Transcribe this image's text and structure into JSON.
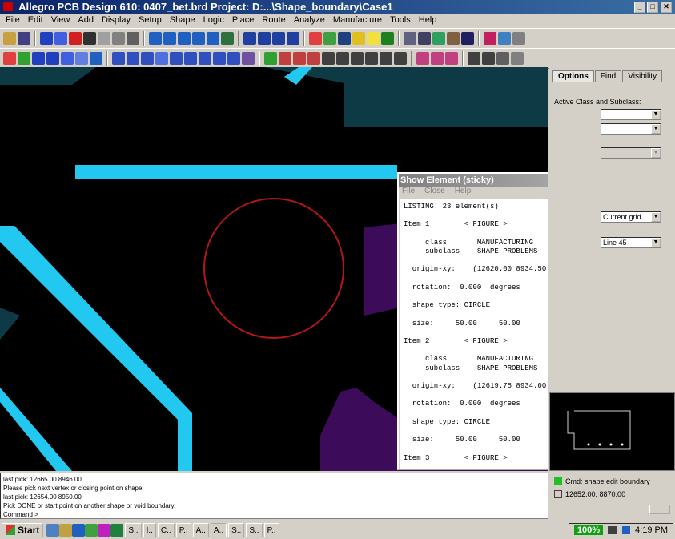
{
  "app": {
    "title": "Allegro PCB Design 610: 0407_bet.brd  Project: D:...\\Shape_boundary\\Case1",
    "window_buttons": [
      "_",
      "□",
      "✕"
    ]
  },
  "menu": [
    "File",
    "Edit",
    "View",
    "Add",
    "Display",
    "Setup",
    "Shape",
    "Logic",
    "Place",
    "Route",
    "Analyze",
    "Manufacture",
    "Tools",
    "Help"
  ],
  "toolbar_icons_row1": [
    "open-icon",
    "save-icon",
    "move-icon",
    "copy-icon",
    "delete-icon",
    "undo-icon",
    "redo-icon",
    "zoom-in-icon",
    "zoom-out-icon",
    "zoom-fit-icon",
    "zoom-prev-icon",
    "zoom-world-icon",
    "add-line-icon",
    "add-rect-icon",
    "add-text-icon",
    "color-icon",
    "layer-icon",
    "grid-icon",
    "display-icon",
    "info-icon"
  ],
  "colors": {
    "canvas_bg": "#000000",
    "cyan_etch": "#22c8f0",
    "dark_teal": "#0e3a46",
    "purple_shape": "#3c0c5a",
    "circle": "#b01818"
  },
  "panel": {
    "tabs": [
      "Options",
      "Find",
      "Visibility"
    ],
    "active_label": "Active Class and Subclass:",
    "combos": [
      "",
      "",
      "",
      "Current grid",
      "Line 45"
    ]
  },
  "show_element": {
    "title": "Show Element (sticky)",
    "menu": [
      "File",
      "Close",
      "Help"
    ],
    "lines": [
      "LISTING: 23 element(s)",
      "",
      "Item 1        < FIGURE >",
      "",
      "     class       MANUFACTURING",
      "     subclass    SHAPE PROBLEMS",
      "",
      "  origin-xy:    (12620.00 8934.50)",
      "",
      "  rotation:  0.000  degrees",
      "",
      "  shape type: CIRCLE",
      "",
      "  size:     50.00     50.00",
      "",
      "Item 2        < FIGURE >",
      "",
      "     class       MANUFACTURING",
      "     subclass    SHAPE PROBLEMS",
      "",
      "  origin-xy:    (12619.75 8934.00)",
      "",
      "  rotation:  0.000  degrees",
      "",
      "  shape type: CIRCLE",
      "",
      "  size:     50.00     50.00",
      "",
      "Item 3        < FIGURE >"
    ]
  },
  "command": {
    "lines": [
      "last pick:  12665.00  8946.00",
      "Please pick next vertex or closing point on shape",
      "last pick:  12654.00  8950.00",
      "Pick DONE or start point on another shape or void boundary.",
      "Command >"
    ]
  },
  "status": {
    "mode": "Cmd:  shape edit boundary",
    "coords": "12652.00, 8870.00"
  },
  "taskbar": {
    "start": "Start",
    "tasks": [
      "S..",
      "I..",
      "C..",
      "P..",
      "A..",
      "A..",
      "S..",
      "S..",
      "P.."
    ],
    "battery": "100%",
    "clock": "4:19 PM"
  }
}
